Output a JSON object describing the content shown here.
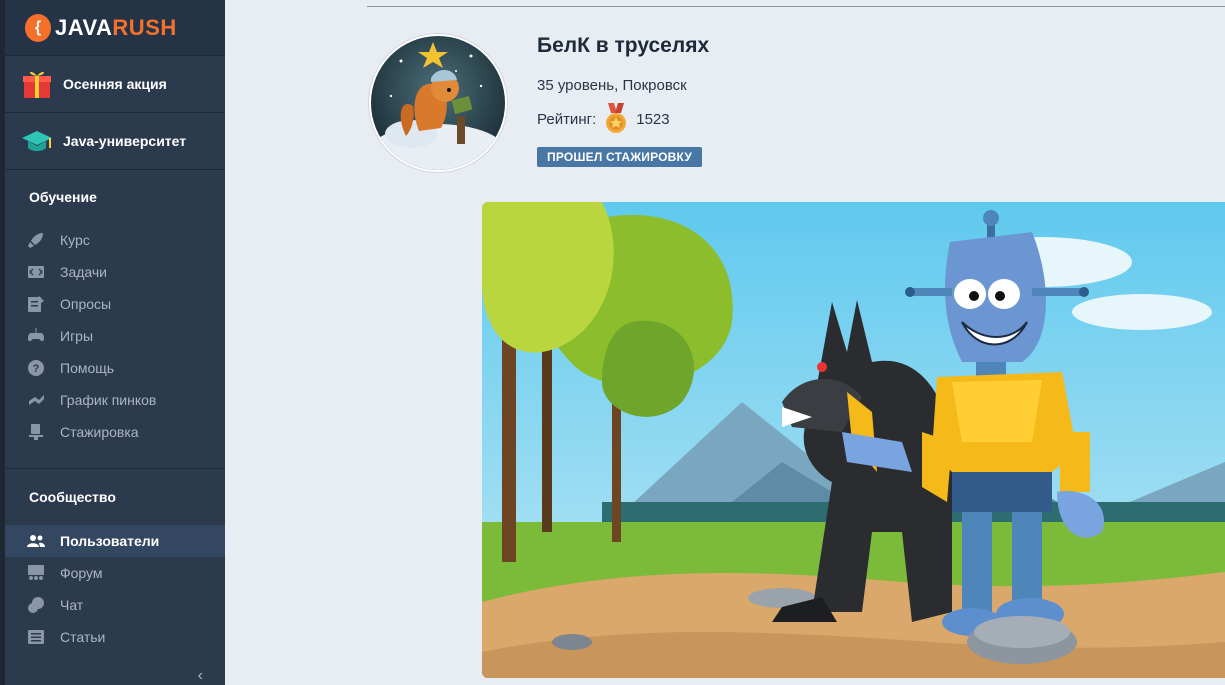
{
  "logo": {
    "java": "JAVA",
    "rush": "RUSH",
    "mark": "{"
  },
  "promos": [
    {
      "label": "Осенняя акция",
      "icon": "gift-icon"
    },
    {
      "label": "Java-университет",
      "icon": "graduation-cap-icon"
    }
  ],
  "learning": {
    "title": "Обучение",
    "items": [
      {
        "label": "Курс",
        "icon": "rocket-icon"
      },
      {
        "label": "Задачи",
        "icon": "code-icon"
      },
      {
        "label": "Опросы",
        "icon": "survey-icon"
      },
      {
        "label": "Игры",
        "icon": "gamepad-icon"
      },
      {
        "label": "Помощь",
        "icon": "help-icon"
      },
      {
        "label": "График пинков",
        "icon": "kick-schedule-icon"
      },
      {
        "label": "Стажировка",
        "icon": "internship-icon"
      }
    ]
  },
  "community": {
    "title": "Сообщество",
    "items": [
      {
        "label": "Пользователи",
        "icon": "users-icon",
        "active": true
      },
      {
        "label": "Форум",
        "icon": "forum-icon"
      },
      {
        "label": "Чат",
        "icon": "chat-icon"
      },
      {
        "label": "Статьи",
        "icon": "articles-icon"
      }
    ]
  },
  "collapse_glyph": "‹",
  "profile": {
    "name": "БелК в труселях",
    "level": "35 уровень, Покровск",
    "rating_label": "Рейтинг:",
    "rating_value": "1523",
    "badge": "ПРОШЕЛ СТАЖИРОВКУ"
  },
  "colors": {
    "sidebar_bg": "#2b3a4d",
    "accent_orange": "#f5702b",
    "badge_blue": "#4877a6",
    "page_bg": "#e8ecf3"
  }
}
